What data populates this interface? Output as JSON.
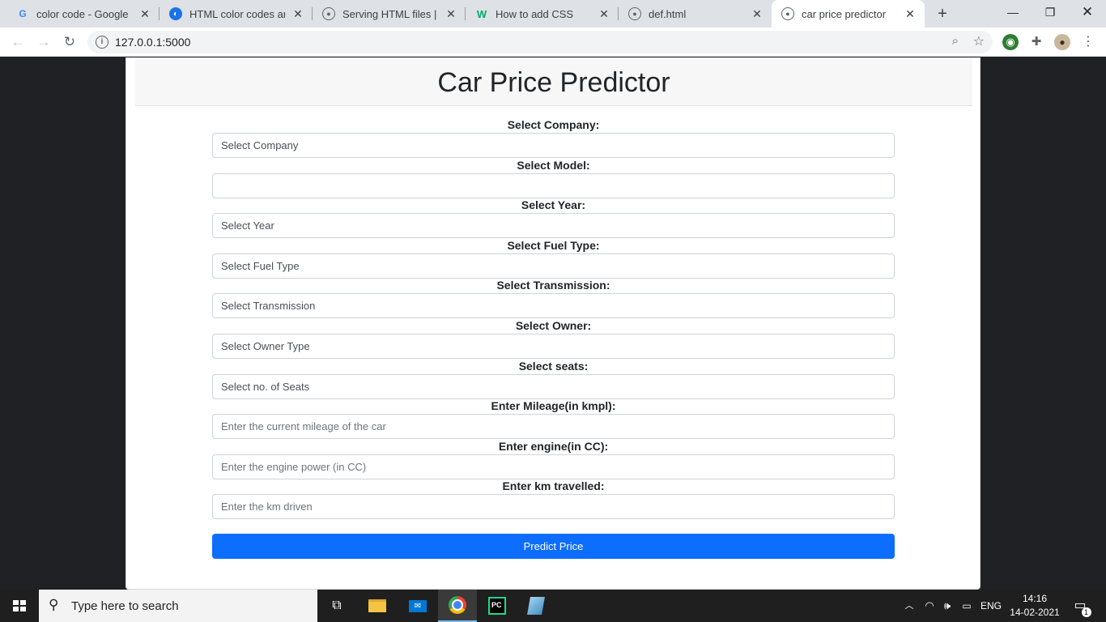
{
  "browser": {
    "tabs": [
      {
        "title": "color code - Google Se",
        "icon": "google-icon"
      },
      {
        "title": "HTML color codes and",
        "icon": "htmlcolorcodes-icon"
      },
      {
        "title": "Serving HTML files | Lea",
        "icon": "globe-icon"
      },
      {
        "title": "How to add CSS",
        "icon": "w3schools-icon"
      },
      {
        "title": "def.html",
        "icon": "globe-icon"
      },
      {
        "title": "car price predictor",
        "icon": "globe-icon",
        "active": true
      }
    ],
    "url": "127.0.0.1:5000"
  },
  "page": {
    "title": "Car Price Predictor",
    "fields": [
      {
        "label": "Select Company:",
        "value": "Select Company",
        "type": "select"
      },
      {
        "label": "Select Model:",
        "value": "",
        "type": "select"
      },
      {
        "label": "Select Year:",
        "value": "Select Year",
        "type": "select"
      },
      {
        "label": "Select Fuel Type:",
        "value": "Select Fuel Type",
        "type": "select"
      },
      {
        "label": "Select Transmission:",
        "value": "Select Transmission",
        "type": "select"
      },
      {
        "label": "Select Owner:",
        "value": "Select Owner Type",
        "type": "select"
      },
      {
        "label": "Select seats:",
        "value": "Select no. of Seats",
        "type": "select"
      },
      {
        "label": "Enter Mileage(in kmpl):",
        "placeholder": "Enter the current mileage of the car",
        "type": "input"
      },
      {
        "label": "Enter engine(in CC):",
        "placeholder": "Enter the engine power (in CC)",
        "type": "input"
      },
      {
        "label": "Enter km travelled:",
        "placeholder": "Enter the km driven",
        "type": "input"
      }
    ],
    "submit_label": "Predict Price",
    "colors": {
      "primary": "#0d6efd",
      "background": "#202124",
      "header": "#f7f7f7"
    }
  },
  "taskbar": {
    "search_placeholder": "Type here to search",
    "language": "ENG",
    "time": "14:16",
    "date": "14-02-2021",
    "notification_count": "1"
  }
}
